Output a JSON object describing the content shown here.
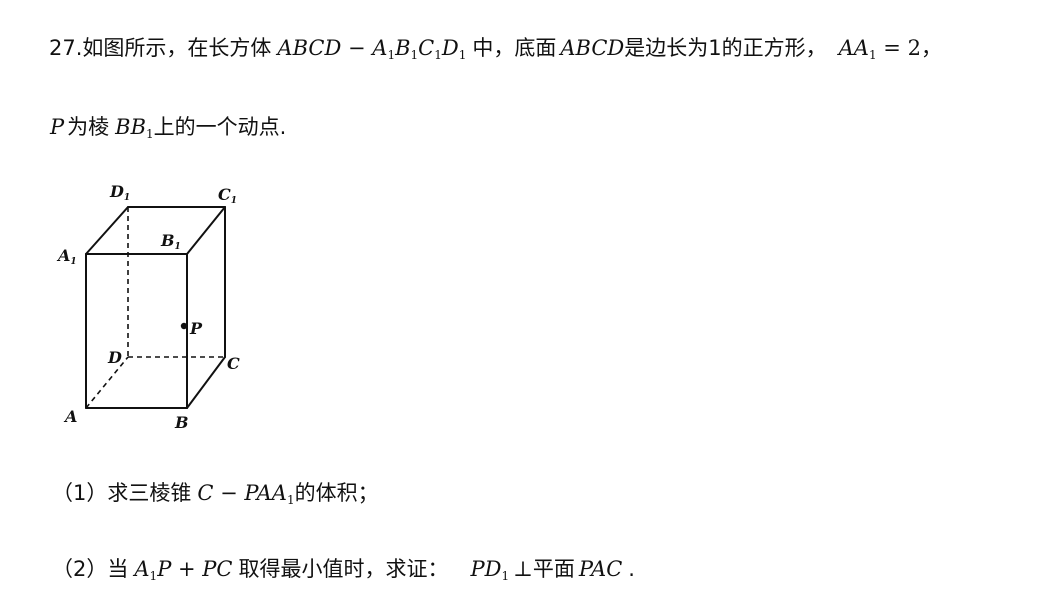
{
  "problem": {
    "number": "27.",
    "intro_text": "如图所示，在长方体",
    "solid_name": "ABCD",
    "solid_dash": " − ",
    "top_A": "A",
    "top_B": "B",
    "top_C": "C",
    "top_D": "D",
    "sub_1": "1",
    "middle_text": "中，底面",
    "base_name": "ABCD",
    "base_desc": "是边长为1的正方形，",
    "edge_AA": "AA",
    "edge_eq": " = 2",
    "comma": "，",
    "point_P": "P",
    "point_text": "为棱",
    "edge_BB": "BB",
    "point_end": "上的一个动点."
  },
  "figure": {
    "labels": {
      "D1": "D",
      "C1": "C",
      "A1": "A",
      "B1": "B",
      "P": "P",
      "D": "D",
      "C": "C",
      "A": "A",
      "B": "B",
      "sub": "1"
    }
  },
  "question1": {
    "number": "（1）",
    "text_before": "求三棱锥",
    "expr_C": "C",
    "expr_dash": " − ",
    "expr_PAA": "PAA",
    "text_after": "的体积；"
  },
  "question2": {
    "number": "（2）",
    "text_when": "当",
    "expr_A": "A",
    "expr_P": "P",
    "expr_plus": " + ",
    "expr_PC": "PC",
    "text_min": "取得最小值时，求证：",
    "expr_PD": "PD",
    "perp": "⊥",
    "text_plane": "平面",
    "expr_PAC": "PAC",
    "period": "."
  }
}
